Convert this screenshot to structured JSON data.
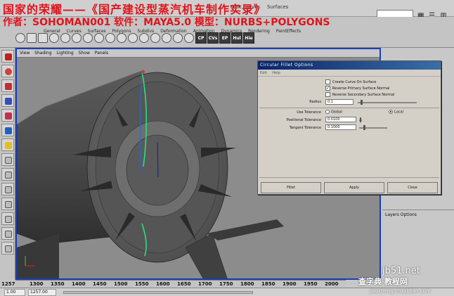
{
  "header": {
    "title_cn": "国家的荣耀——《国产建设型蒸汽机车制作实录》",
    "author_cn": "作者：SOHOMAN001  软件：MAYA5.0  模型：NURBS+POLYGONS"
  },
  "menubar": {
    "items": [
      "Modeling",
      "Edit NURBS",
      "Polygons",
      "Edit Polygons",
      "Subdiv Surfaces",
      "Render",
      "Edit Curves",
      "Surfaces"
    ]
  },
  "shelf": {
    "tabs": [
      "General",
      "Curves",
      "Surfaces",
      "Polygons",
      "Subdivs",
      "Deformation",
      "Animation",
      "Dynamics",
      "Rendering",
      "PaintEffects",
      "Cloth",
      "Fluids",
      "Fur",
      "Custom"
    ],
    "buttons": [
      "CP",
      "CVs",
      "EP",
      "Hul",
      "Hie"
    ]
  },
  "viewport": {
    "menu": [
      "View",
      "Shading",
      "Lighting",
      "Show",
      "Panels"
    ]
  },
  "dialog": {
    "title": "Circular Fillet Options",
    "menu": [
      "Edit",
      "Help"
    ],
    "create_curve": "Create Curve On Surface",
    "reverse_primary": "Reverse Primary Surface Normal",
    "reverse_secondary": "Reverse Secondary Surface Normal",
    "radius_label": "Radius",
    "radius_value": "0.1",
    "use_tolerance_label": "Use Tolerance",
    "opt_global": "Global",
    "opt_local": "Local",
    "positional_label": "Positional Tolerance",
    "positional_value": "0.0100",
    "tangent_label": "Tangent Tolerance",
    "tangent_value": "0.1000",
    "btn_fillet": "Fillet",
    "btn_apply": "Apply",
    "btn_close": "Close",
    "checks": {
      "create_curve": false,
      "reverse_primary": true,
      "reverse_secondary": false
    },
    "tolerance": "Local"
  },
  "layers": {
    "heading": "Layers  Options"
  },
  "timeline": {
    "ticks": [
      "1300",
      "1350",
      "1400",
      "1450",
      "1500",
      "1550",
      "1600",
      "1650",
      "1700",
      "1750",
      "1800",
      "1850",
      "1900",
      "1950",
      "2000",
      "2050"
    ],
    "current": "1257",
    "range_start": "1.00",
    "range_field": "1257.00"
  },
  "watermark": {
    "line1": "jb51.net",
    "line2": "查字典 教程网",
    "line3": "jiaocheng.chazidian.com"
  },
  "colors": {
    "title_red": "#e0141b",
    "viewport_border": "#1b3fb3",
    "dialog_title": "#0a246a",
    "curve_green": "#29e07c"
  }
}
